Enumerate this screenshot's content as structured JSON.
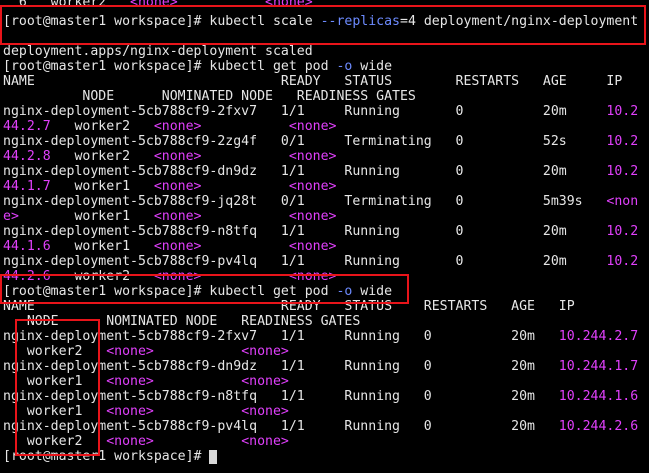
{
  "terminal": {
    "lines": [
      [
        {
          "t": "  6   worker2   "
        },
        {
          "t": "<none>",
          "c": "pink"
        },
        {
          "t": "           "
        },
        {
          "t": "<none>",
          "c": "pink"
        }
      ],
      [
        {
          "t": "[root@master1 workspace]# kubectl scale "
        },
        {
          "t": "--replicas",
          "c": "blue"
        },
        {
          "t": "=4 deployment/nginx-deployment"
        }
      ],
      [
        {
          "t": ""
        }
      ],
      [
        {
          "t": "deployment.apps/nginx-deployment scaled"
        }
      ],
      [
        {
          "t": "[root@master1 workspace]# kubectl get pod "
        },
        {
          "t": "-o",
          "c": "blue"
        },
        {
          "t": " wide"
        }
      ],
      [
        {
          "t": "NAME                               READY   STATUS        RESTARTS   AGE     IP"
        }
      ],
      [
        {
          "t": "          NODE      NOMINATED NODE   READINESS GATES"
        }
      ],
      [
        {
          "t": "nginx-deployment-5cb788cf9-2fxv7   1/1     Running       0          20m     "
        },
        {
          "t": "10.2",
          "c": "pink"
        }
      ],
      [
        {
          "t": "44.2.7",
          "c": "pink"
        },
        {
          "t": "   worker2   "
        },
        {
          "t": "<none>",
          "c": "pink"
        },
        {
          "t": "           "
        },
        {
          "t": "<none>",
          "c": "pink"
        }
      ],
      [
        {
          "t": "nginx-deployment-5cb788cf9-2zg4f   0/1     Terminating   0          52s     "
        },
        {
          "t": "10.2",
          "c": "pink"
        }
      ],
      [
        {
          "t": "44.2.8",
          "c": "pink"
        },
        {
          "t": "   worker2   "
        },
        {
          "t": "<none>",
          "c": "pink"
        },
        {
          "t": "           "
        },
        {
          "t": "<none>",
          "c": "pink"
        }
      ],
      [
        {
          "t": "nginx-deployment-5cb788cf9-dn9dz   1/1     Running       0          20m     "
        },
        {
          "t": "10.2",
          "c": "pink"
        }
      ],
      [
        {
          "t": "44.1.7",
          "c": "pink"
        },
        {
          "t": "   worker1   "
        },
        {
          "t": "<none>",
          "c": "pink"
        },
        {
          "t": "           "
        },
        {
          "t": "<none>",
          "c": "pink"
        }
      ],
      [
        {
          "t": "nginx-deployment-5cb788cf9-jq28t   0/1     Terminating   0          5m39s   "
        },
        {
          "t": "<non",
          "c": "pink"
        }
      ],
      [
        {
          "t": "e>",
          "c": "pink"
        },
        {
          "t": "       worker1   "
        },
        {
          "t": "<none>",
          "c": "pink"
        },
        {
          "t": "           "
        },
        {
          "t": "<none>",
          "c": "pink"
        }
      ],
      [
        {
          "t": "nginx-deployment-5cb788cf9-n8tfq   1/1     Running       0          20m     "
        },
        {
          "t": "10.2",
          "c": "pink"
        }
      ],
      [
        {
          "t": "44.1.6",
          "c": "pink"
        },
        {
          "t": "   worker1   "
        },
        {
          "t": "<none>",
          "c": "pink"
        },
        {
          "t": "           "
        },
        {
          "t": "<none>",
          "c": "pink"
        }
      ],
      [
        {
          "t": "nginx-deployment-5cb788cf9-pv4lq   1/1     Running       0          20m     "
        },
        {
          "t": "10.2",
          "c": "pink"
        }
      ],
      [
        {
          "t": "44.2.6",
          "c": "pink"
        },
        {
          "t": "   worker2   "
        },
        {
          "t": "<none>",
          "c": "pink"
        },
        {
          "t": "           "
        },
        {
          "t": "<none>",
          "c": "pink"
        }
      ],
      [
        {
          "t": "[root@master1 workspace]# kubectl get pod "
        },
        {
          "t": "-o",
          "c": "blue"
        },
        {
          "t": " wide"
        }
      ],
      [
        {
          "t": "NAME                               READY   STATUS    RESTARTS   AGE   IP"
        }
      ],
      [
        {
          "t": "   NODE      NOMINATED NODE   READINESS GATES"
        }
      ],
      [
        {
          "t": "nginx-deployment-5cb788cf9-2fxv7   1/1     Running   0          20m   "
        },
        {
          "t": "10.244.2.7",
          "c": "pink"
        }
      ],
      [
        {
          "t": "   worker2   "
        },
        {
          "t": "<none>",
          "c": "pink"
        },
        {
          "t": "           "
        },
        {
          "t": "<none>",
          "c": "pink"
        }
      ],
      [
        {
          "t": "nginx-deployment-5cb788cf9-dn9dz   1/1     Running   0          20m   "
        },
        {
          "t": "10.244.1.7",
          "c": "pink"
        }
      ],
      [
        {
          "t": "   worker1   "
        },
        {
          "t": "<none>",
          "c": "pink"
        },
        {
          "t": "           "
        },
        {
          "t": "<none>",
          "c": "pink"
        }
      ],
      [
        {
          "t": "nginx-deployment-5cb788cf9-n8tfq   1/1     Running   0          20m   "
        },
        {
          "t": "10.244.1.6",
          "c": "pink"
        }
      ],
      [
        {
          "t": "   worker1   "
        },
        {
          "t": "<none>",
          "c": "pink"
        },
        {
          "t": "           "
        },
        {
          "t": "<none>",
          "c": "pink"
        }
      ],
      [
        {
          "t": "nginx-deployment-5cb788cf9-pv4lq   1/1     Running   0          20m   "
        },
        {
          "t": "10.244.2.6",
          "c": "pink"
        }
      ],
      [
        {
          "t": "   worker2   "
        },
        {
          "t": "<none>",
          "c": "pink"
        },
        {
          "t": "           "
        },
        {
          "t": "<none>",
          "c": "pink"
        }
      ],
      [
        {
          "t": "[root@master1 workspace]# "
        }
      ]
    ]
  },
  "colors": {
    "background": "#000000",
    "text": "#e6e6e6",
    "highlight": "#e040fb",
    "option": "#6d8bff",
    "annotation_box": "#e8141a"
  }
}
